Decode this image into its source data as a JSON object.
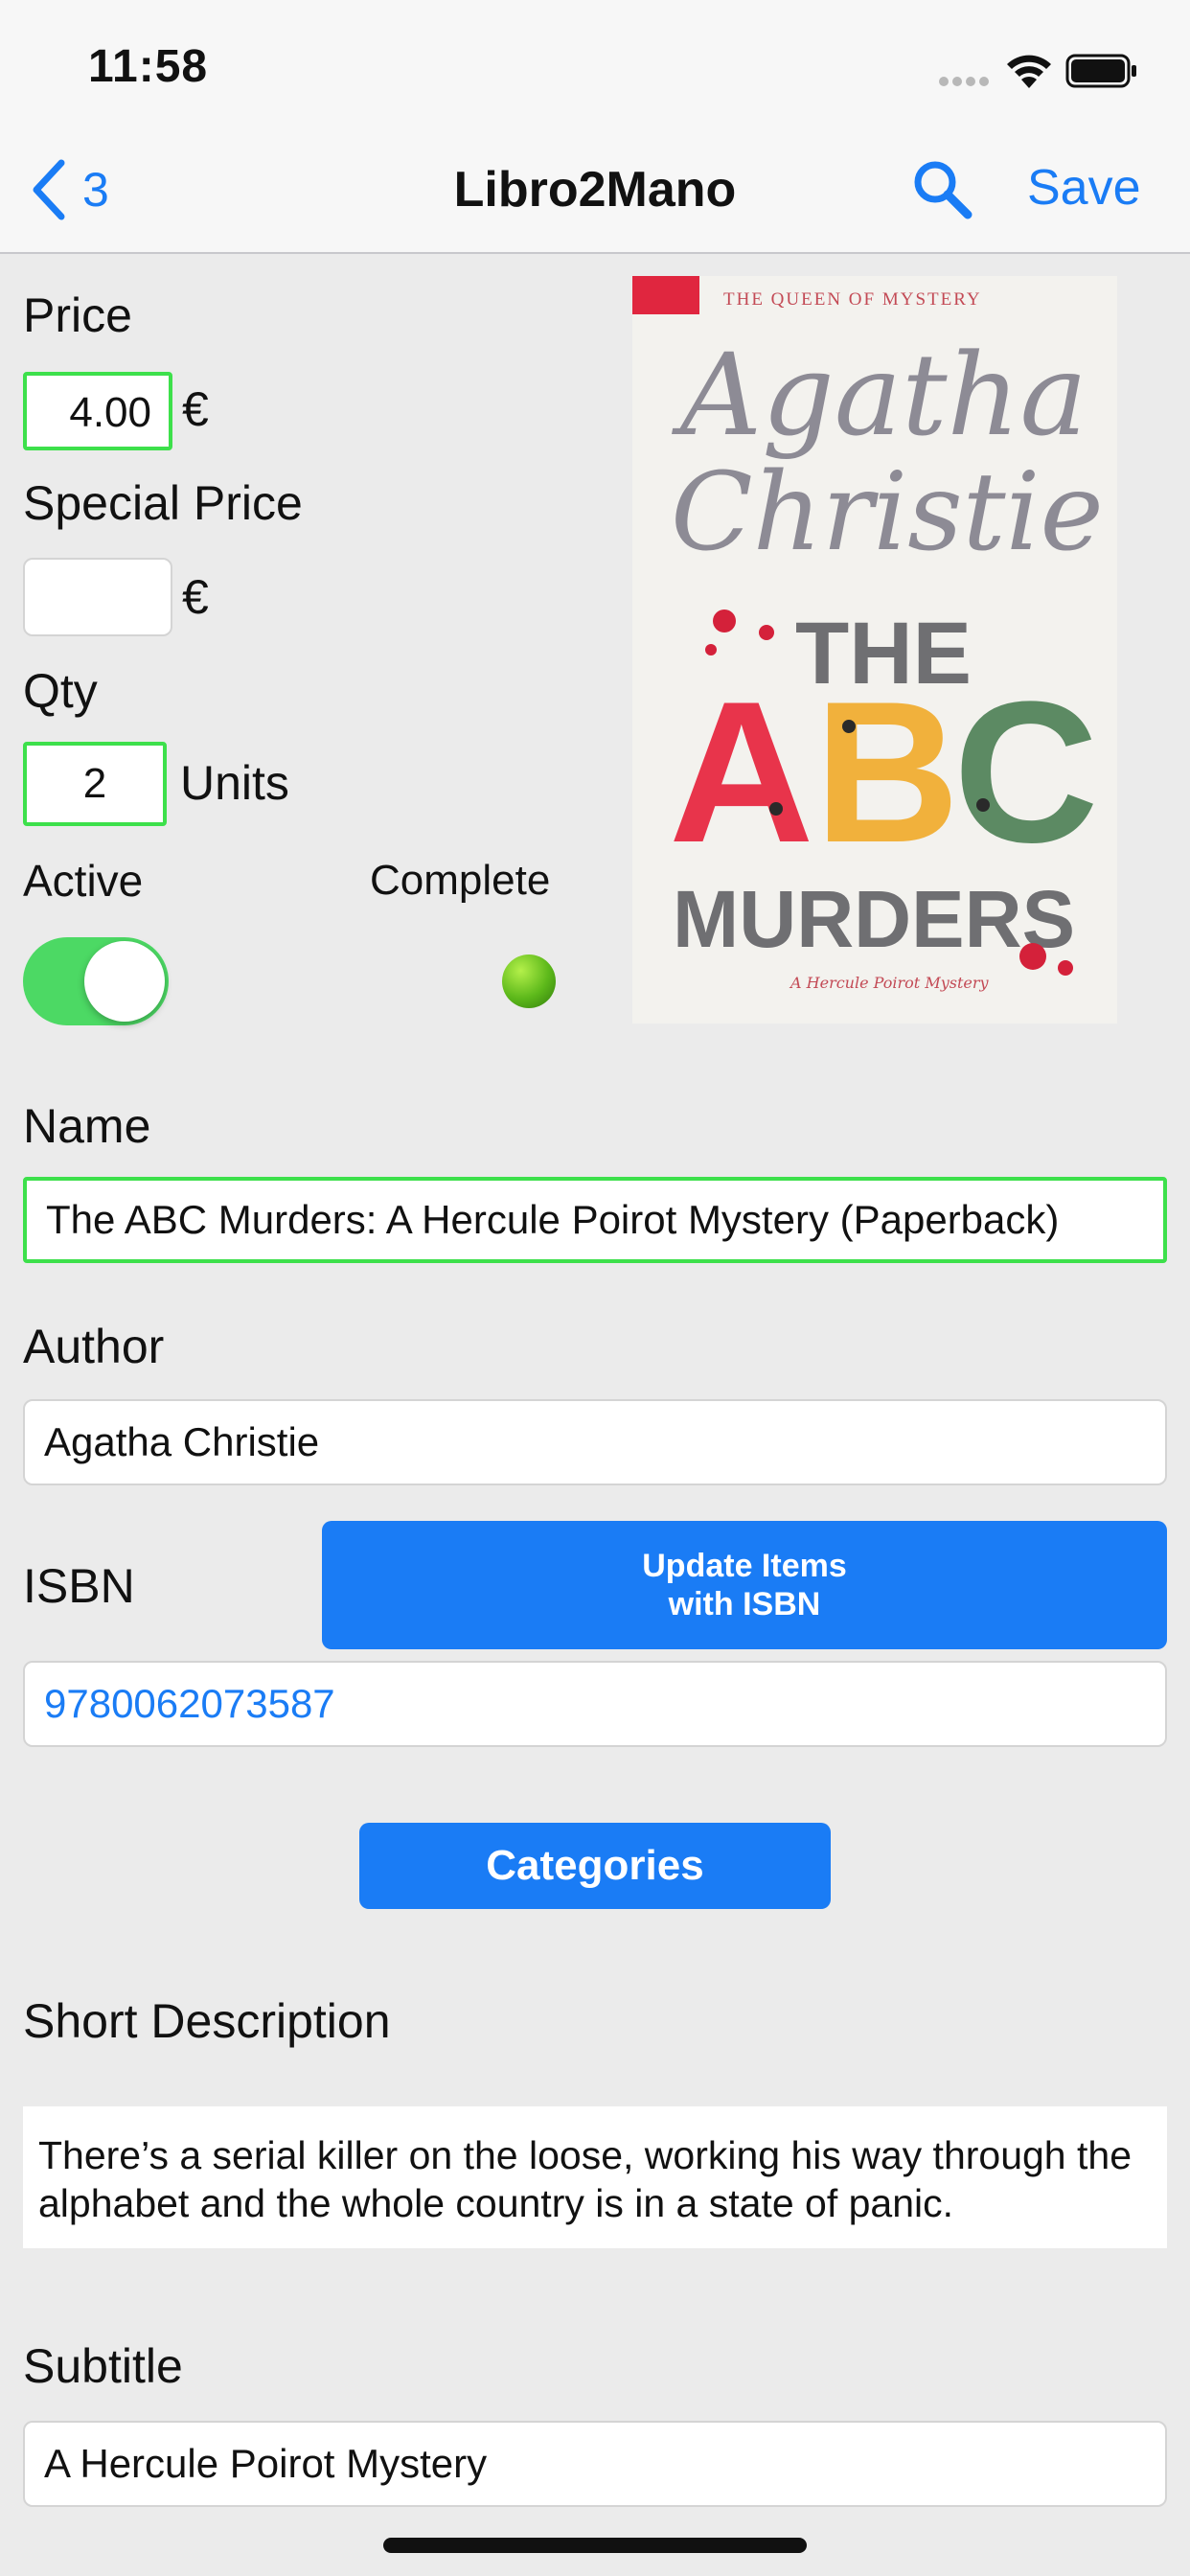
{
  "status_bar": {
    "time": "11:58"
  },
  "nav": {
    "back_count": "3",
    "title": "Libro2Mano",
    "save_label": "Save"
  },
  "form": {
    "price_label": "Price",
    "price_value": "4.00",
    "currency": "€",
    "special_price_label": "Special Price",
    "special_price_value": "",
    "qty_label": "Qty",
    "qty_value": "2",
    "qty_unit": "Units",
    "active_label": "Active",
    "active_on": true,
    "complete_label": "Complete",
    "name_label": "Name",
    "name_value": "The ABC Murders: A Hercule Poirot Mystery (Paperback)",
    "author_label": "Author",
    "author_value": "Agatha Christie",
    "isbn_label": "ISBN",
    "update_isbn_button_line1": "Update Items",
    "update_isbn_button_line2": "with ISBN",
    "isbn_value": "9780062073587",
    "categories_button": "Categories",
    "short_description_label": "Short Description",
    "short_description_value": "There’s a serial killer on the loose, working his way through the alphabet and the whole country is in a state of panic.",
    "subtitle_label": "Subtitle",
    "subtitle_value": "A Hercule Poirot Mystery"
  },
  "cover": {
    "top_line": "THE QUEEN OF MYSTERY",
    "author_line1": "Agatha",
    "author_line2": "Christie",
    "title_the": "THE",
    "title_a": "A",
    "title_b": "B",
    "title_c": "C",
    "title_murders": "MURDERS",
    "series_line": "A Hercule Poirot Mystery"
  },
  "colors": {
    "accent": "#1a7cf5",
    "valid_border": "#3de04b",
    "toggle_on": "#4cd964",
    "complete_dot": "#5cb81a"
  },
  "icons": [
    "chevron-left-icon",
    "search-icon",
    "wifi-icon",
    "battery-icon",
    "signal-icon"
  ]
}
